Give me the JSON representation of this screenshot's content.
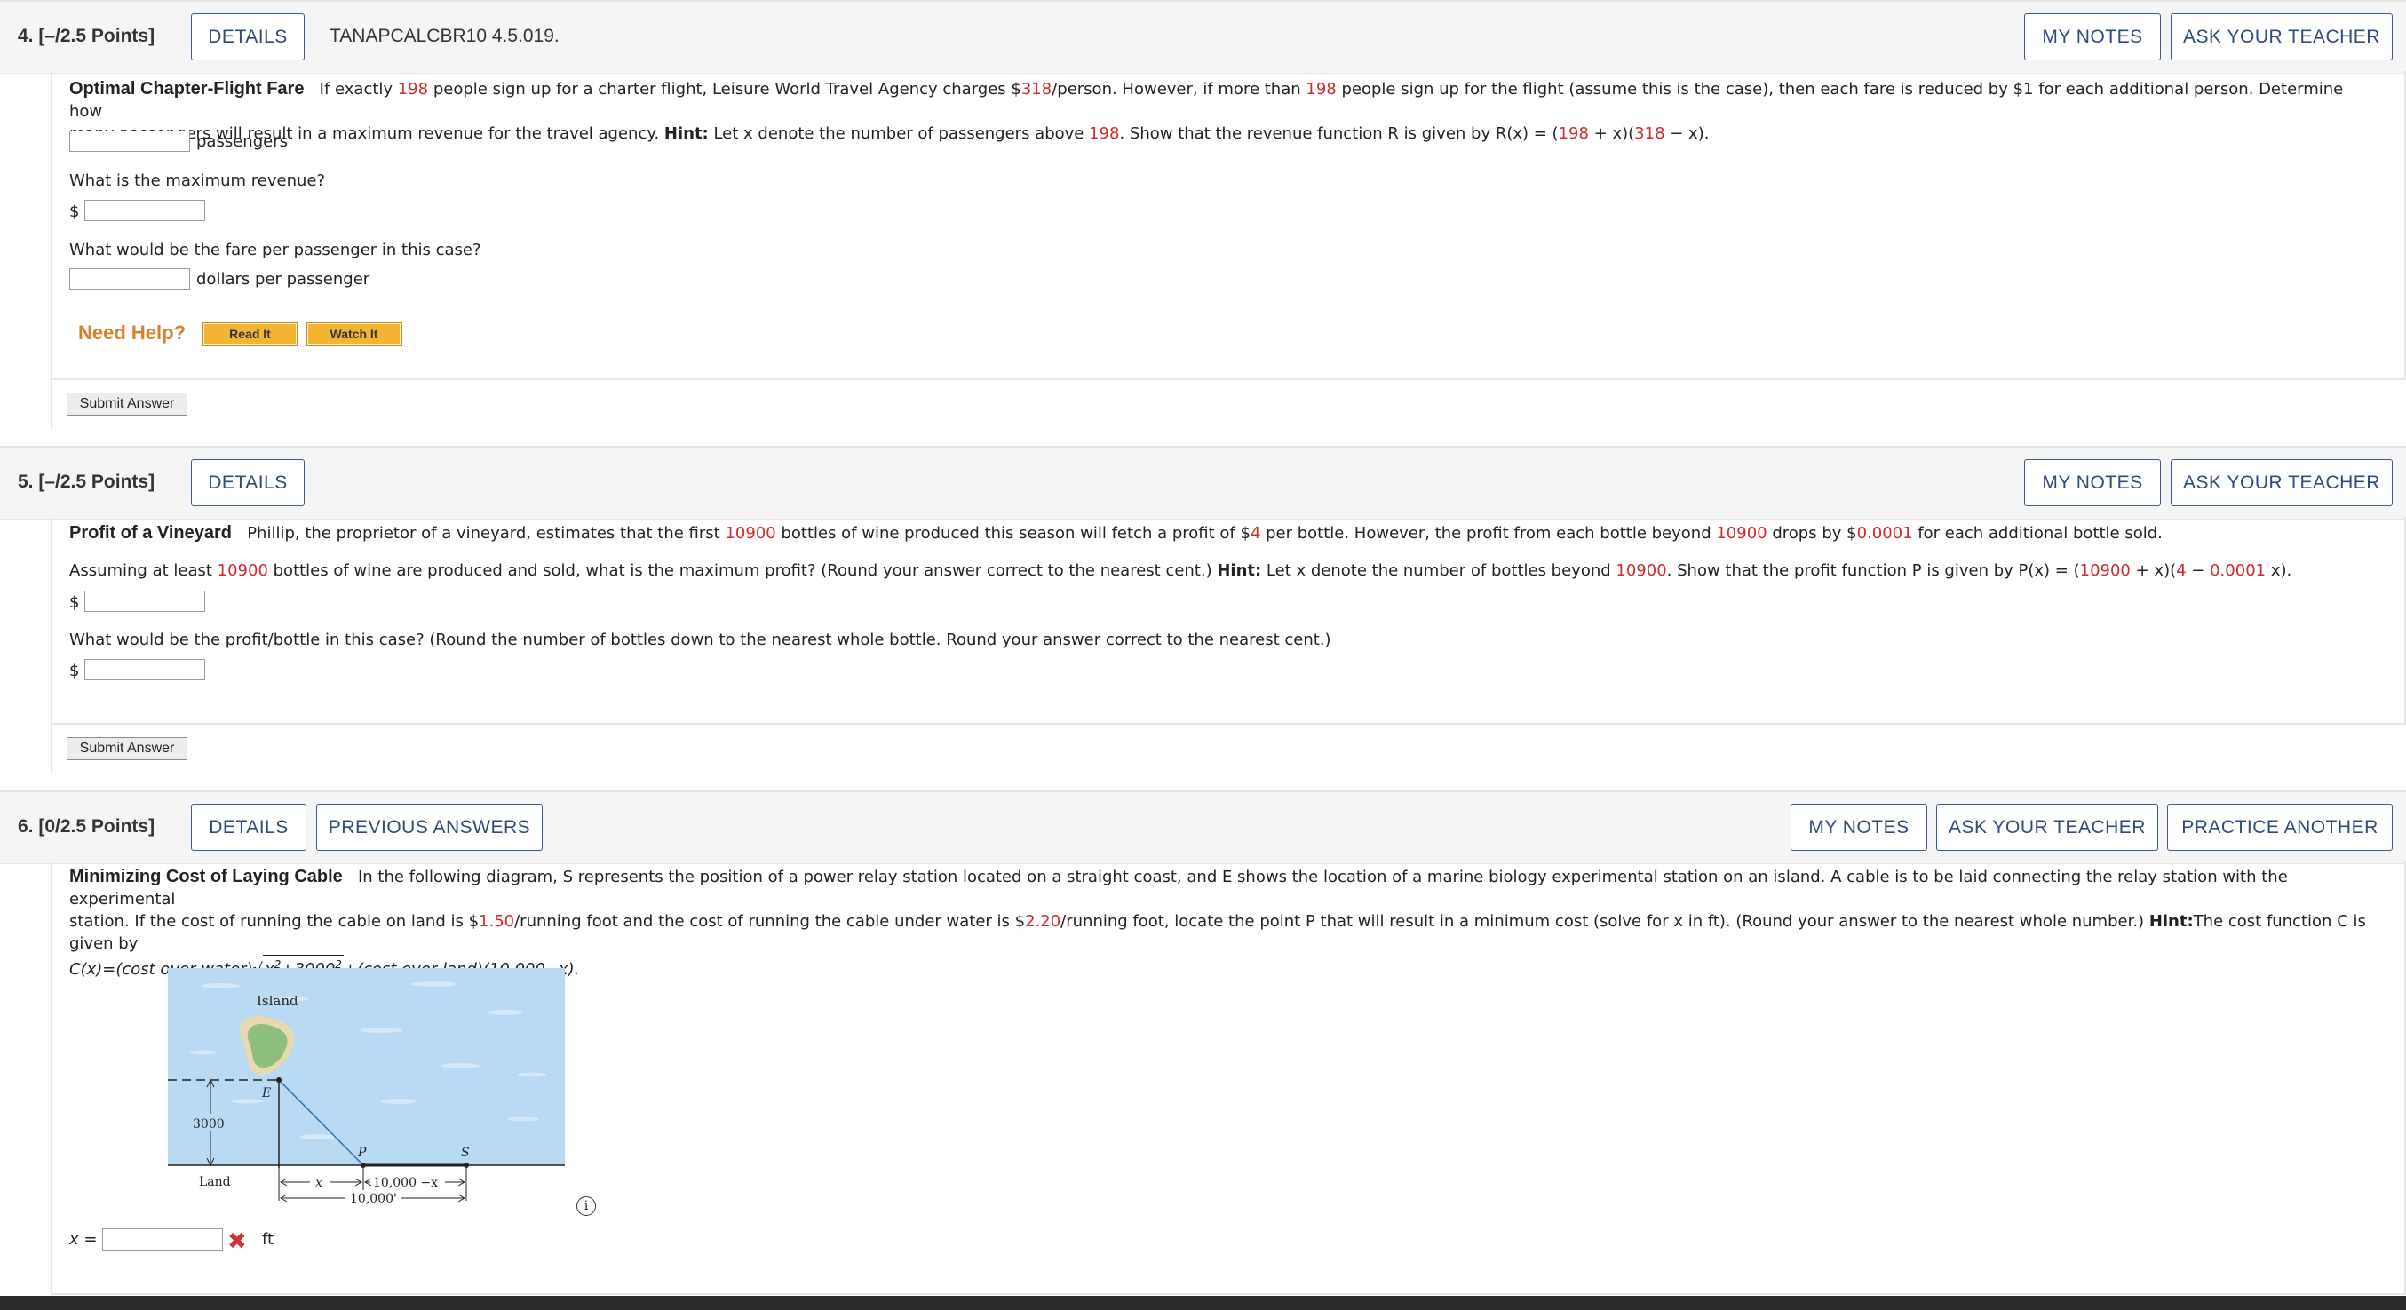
{
  "q4": {
    "number": "4.",
    "points": "[–/2.5 Points]",
    "details": "DETAILS",
    "code": "TANAPCALCBR10 4.5.019.",
    "my_notes": "MY NOTES",
    "ask_teacher": "ASK YOUR TEACHER",
    "title": "Optimal Chapter-Flight Fare",
    "t1": "If exactly ",
    "n198a": "198",
    "t2": " people sign up for a charter flight, Leisure World Travel Agency charges $",
    "n318": "318",
    "t3": "/person. However, if more than ",
    "n198b": "198",
    "t4": " people sign up for the flight (assume this is the case), then each fare is reduced by $1 for each additional person. Determine how",
    "t5": "many passengers will result in a maximum revenue for the travel agency. ",
    "hint_label": "Hint:",
    "t6": " Let x denote the number of passengers above ",
    "n198c": "198",
    "t7": ". Show that the revenue function R is given by R(x) = (",
    "n198d": "198",
    "t8": " + x)(",
    "n318b": "318",
    "t9": " − x).",
    "unit1": "passengers",
    "q2": "What is the maximum revenue?",
    "dollar": "$",
    "q3": "What would be the fare per passenger in this case?",
    "unit3": "dollars per passenger",
    "need_help": "Need Help?",
    "read_it": "Read It",
    "watch_it": "Watch It",
    "submit": "Submit Answer"
  },
  "q5": {
    "number": "5.",
    "points": "[–/2.5 Points]",
    "details": "DETAILS",
    "my_notes": "MY NOTES",
    "ask_teacher": "ASK YOUR TEACHER",
    "title": "Profit of a Vineyard",
    "t1": "Phillip, the proprietor of a vineyard, estimates that the first ",
    "n1": "10900",
    "t2": " bottles of wine produced this season will fetch a profit of $",
    "n2": "4",
    "t3": " per bottle. However, the profit from each bottle beyond ",
    "n3": "10900",
    "t4": " drops by $",
    "n4": "0.0001",
    "t5": " for each additional bottle sold.",
    "p2a": "Assuming at least ",
    "p2n1": "10900",
    "p2b": " bottles of wine are produced and sold, what is the maximum profit? (Round your answer correct to the nearest cent.) ",
    "hint_label": "Hint:",
    "p2c": " Let x denote the number of bottles beyond ",
    "p2n2": "10900",
    "p2d": ". Show that the profit function P is given by P(x) = (",
    "p2n3": "10900",
    "p2e": " + x)(",
    "p2n4": "4",
    "p2f": " − ",
    "p2n5": "0.0001",
    "p2g": " x).",
    "dollar": "$",
    "q3": "What would be the profit/bottle in this case? (Round the number of bottles down to the nearest whole bottle. Round your answer correct to the nearest cent.)",
    "submit": "Submit Answer"
  },
  "q6": {
    "number": "6.",
    "points": "[0/2.5 Points]",
    "details": "DETAILS",
    "previous": "PREVIOUS ANSWERS",
    "my_notes": "MY NOTES",
    "ask_teacher": "ASK YOUR TEACHER",
    "practice": "PRACTICE ANOTHER",
    "title": "Minimizing Cost of Laying Cable",
    "t1": "In the following diagram, S represents the position of a power relay station located on a straight coast, and E shows the location of a marine biology experimental station on an island. A cable is to be laid connecting the relay station with the experimental",
    "t2": "station. If the cost of running the cable on land is $",
    "n1": "1.50",
    "t3": "/running foot and the cost of running the cable under water is $",
    "n2": "2.20",
    "t4": "/running foot, locate the point P that will result in a minimum cost (solve for x in ft). (Round your answer to the nearest whole number.) ",
    "hint_label": "Hint:",
    "t5": "The cost function C is given by",
    "f1": "C(x)=(cost over water)",
    "f2": "x",
    "f3": "2",
    "f4": "+3000",
    "f5": "2",
    "f6": "+(cost over land)(10,000−x).",
    "diagram": {
      "island": "Island",
      "e": "E",
      "p": "P",
      "s": "S",
      "h3000": "3000'",
      "land": "Land",
      "x": "x",
      "rest": "10,000 −x",
      "total": "10,000'"
    },
    "x_label": "x =",
    "unit": "ft",
    "info": "i"
  },
  "colors": {
    "accent": "#2e4a78",
    "red": "#d12a2a",
    "help": "#d8802b",
    "button_yellow": "#f4b535"
  }
}
